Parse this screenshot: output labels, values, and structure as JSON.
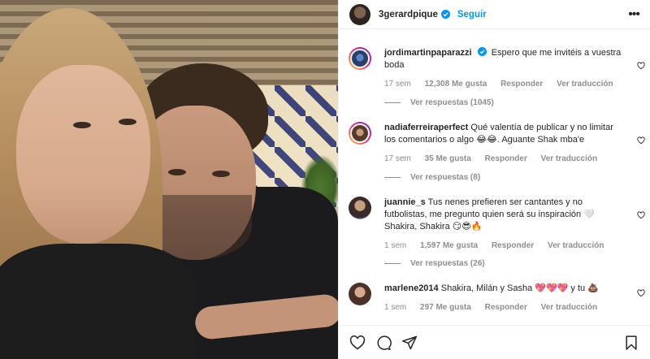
{
  "post": {
    "author": "3gerardpique",
    "follow_label": "Seguir",
    "more_label": "•••"
  },
  "comments": [
    {
      "username": "jordimartinpaparazzi",
      "verified": true,
      "text": "Espero que me invitéis a vuestra boda",
      "time": "17 sem",
      "likes": "12,308 Me gusta",
      "reply": "Responder",
      "translate": "Ver traducción",
      "view_replies": "Ver respuestas (1045)"
    },
    {
      "username": "nadiaferreiraperfect",
      "verified": false,
      "text": "Qué valentía de publicar y no limitar los comentarios o algo 😂😂. Aguante Shak mba'e",
      "time": "17 sem",
      "likes": "35 Me gusta",
      "reply": "Responder",
      "translate": "Ver traducción",
      "view_replies": "Ver respuestas (8)"
    },
    {
      "username": "juannie_s",
      "verified": false,
      "text": "Tus nenes prefieren ser cantantes y no futbolistas, me pregunto quien será su inspiración 🤍 Shakira, Shakira 😏😎🔥",
      "time": "1 sem",
      "likes": "1,597 Me gusta",
      "reply": "Responder",
      "translate": "Ver traducción",
      "view_replies": "Ver respuestas (26)"
    },
    {
      "username": "marlene2014",
      "verified": false,
      "text": "Shakira, Milán y Sasha 💖💖💖 y tu 💩",
      "time": "1 sem",
      "likes": "297 Me gusta",
      "reply": "Responder",
      "translate": "Ver traducción"
    }
  ],
  "icons": {
    "header": "verified-badge-icon",
    "actions": [
      "heart-icon",
      "comment-icon",
      "share-icon",
      "bookmark-icon"
    ]
  },
  "colors": {
    "accent": "#0095f6",
    "text": "#262626",
    "muted": "#8e8e8e"
  }
}
